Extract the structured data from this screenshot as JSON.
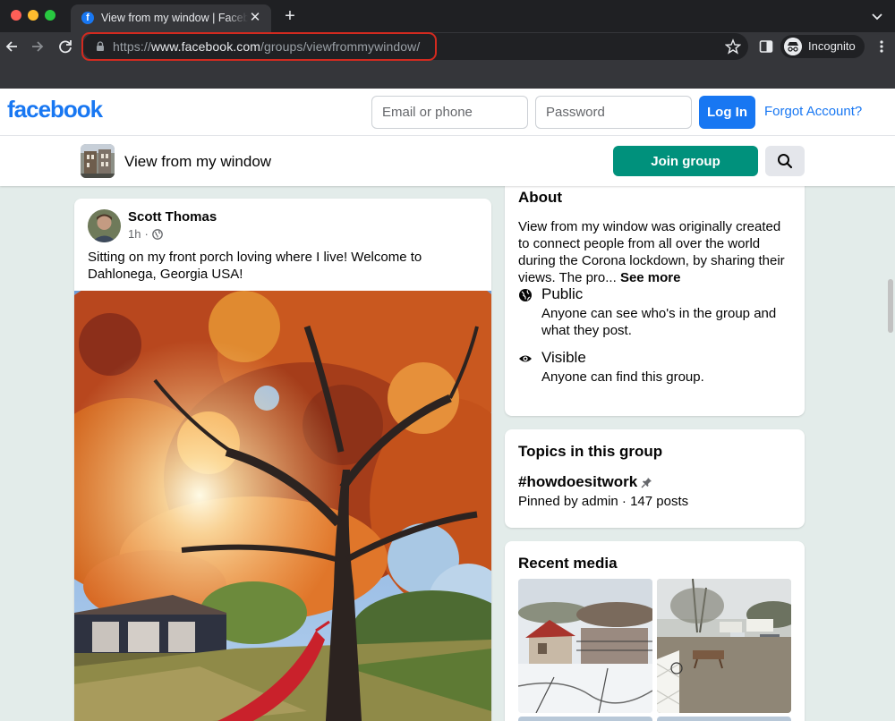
{
  "browser": {
    "tab_title": "View from my window | Facebook",
    "favicon_letter": "f",
    "url_prefix": "https://",
    "url_host": "www.facebook.com",
    "url_path": "/groups/viewfrommywindow/",
    "incognito_label": "Incognito"
  },
  "header": {
    "logo": "facebook",
    "email_placeholder": "Email or phone",
    "password_placeholder": "Password",
    "login_label": "Log In",
    "forgot_label": "Forgot Account?",
    "brand_color": "#1877f2"
  },
  "group": {
    "name": "View from my window",
    "join_label": "Join group",
    "join_color": "#00917c"
  },
  "post": {
    "author": "Scott Thomas",
    "time": "1h",
    "separator": "·",
    "text": "Sitting on my front porch loving where I live! Welcome to Dahlonega, Georgia USA!"
  },
  "about": {
    "title": "About",
    "description": "View from my window was originally created to connect people from all over the world during the Corona lockdown, by sharing their views. The pro...",
    "see_more": "See more",
    "privacy": [
      {
        "icon": "globe-icon",
        "title": "Public",
        "desc": "Anyone can see who's in the group and what they post."
      },
      {
        "icon": "eye-icon",
        "title": "Visible",
        "desc": "Anyone can find this group."
      }
    ]
  },
  "topics": {
    "title": "Topics in this group",
    "hashtag": "#howdoesitwork",
    "meta": "Pinned by admin · 147 posts"
  },
  "media": {
    "title": "Recent media"
  }
}
